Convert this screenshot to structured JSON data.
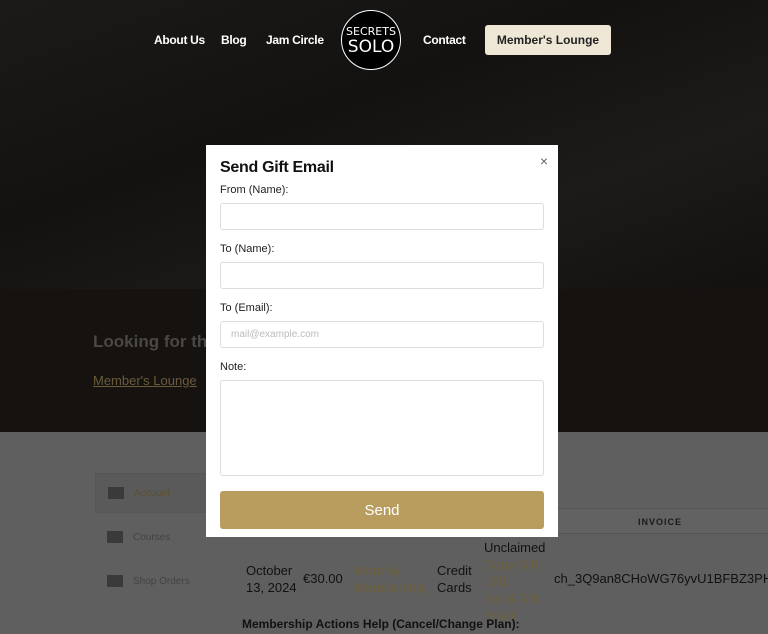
{
  "nav": {
    "items": [
      "About Us",
      "Blog",
      "Jam Circle",
      "Contact"
    ],
    "logo_top": "SECRETS",
    "logo_bottom": "SOLO",
    "cta": "Member's Lounge"
  },
  "band": {
    "heading": "Looking for the",
    "link": "Member's Lounge"
  },
  "sidebar": {
    "items": [
      "Account",
      "Courses",
      "Shop Orders"
    ]
  },
  "table": {
    "header_invoice": "INVOICE",
    "row": {
      "date": "October 13, 2024",
      "amount": "€30.00",
      "plan": "Monthly Membership",
      "method": "Credit Cards",
      "status": "Unclaimed",
      "copy_link": "Copy Gift URL",
      "send_link": "Send Gift Email",
      "invoice": "ch_3Q9an8CHoWG76yvU1BFBZ3PH"
    }
  },
  "footer_text": "Membership Actions Help (Cancel/Change Plan):",
  "modal": {
    "title": "Send Gift Email",
    "close": "×",
    "from_label": "From (Name):",
    "to_label": "To (Name):",
    "email_label": "To (Email):",
    "email_placeholder": "mail@example.com",
    "note_label": "Note:",
    "send": "Send"
  },
  "colors": {
    "accent": "#b89d5e",
    "cta_bg": "#efe7d6"
  }
}
